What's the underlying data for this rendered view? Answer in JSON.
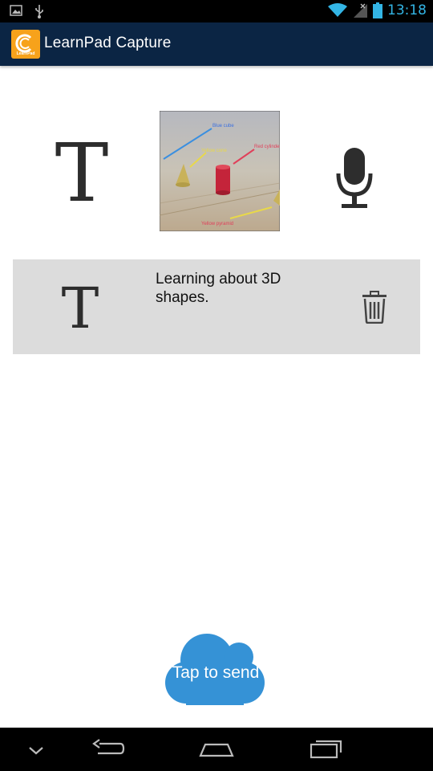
{
  "status_bar": {
    "time": "13:18",
    "icons": [
      "image-notification-icon",
      "usb-icon",
      "wifi-icon",
      "signal-icon",
      "battery-icon"
    ]
  },
  "action_bar": {
    "logo_text": "LearnPad",
    "title": "LearnPad Capture"
  },
  "capture_options": [
    {
      "name": "text-option",
      "glyph": "T"
    },
    {
      "name": "photo-option",
      "labels": [
        "Blue cube",
        "Yellow cone",
        "Red cylinder",
        "Yellow pyramid"
      ]
    },
    {
      "name": "audio-option",
      "icon": "microphone-icon"
    }
  ],
  "entries": [
    {
      "type_glyph": "T",
      "text": "Learning about 3D shapes.",
      "delete_icon": "trash-icon"
    }
  ],
  "send": {
    "label": "Tap to send",
    "color": "#3592d6"
  },
  "nav_bar": {
    "buttons": [
      "hide-keyboard",
      "back",
      "home",
      "recent-apps"
    ]
  },
  "colors": {
    "action_bar": "#0b2544",
    "status_time": "#33b5e5",
    "entry_bg": "#dcdcdc",
    "logo": "#f7a21b"
  }
}
